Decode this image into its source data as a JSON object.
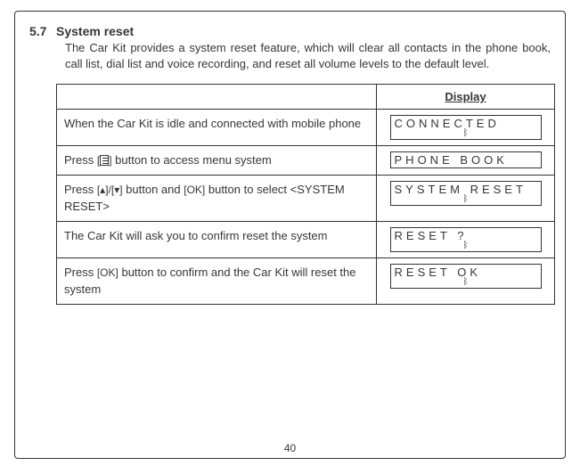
{
  "section_number": "5.7",
  "section_title": "System reset",
  "body": "The Car Kit provides a system reset feature, which will clear all contacts in the phone book, call list, dial list and voice recording, and reset all volume levels to  the default level.",
  "display_header": "Display",
  "steps": [
    {
      "text_pre": "When the Car Kit is idle and connected with mobile phone",
      "lcd": {
        "line1": "CONNECTED",
        "bt": true
      }
    },
    {
      "text_pre": "Press ",
      "key1": "[",
      "icon1": "menu",
      "key1_close": "]",
      "text_post": " button to access menu system",
      "lcd": {
        "line1": "PHONE  BOOK",
        "bt": false
      }
    },
    {
      "text_pre": "Press ",
      "key1": "[▴]/[▾]",
      "text_mid": " button and ",
      "key2": "[OK]",
      "text_post": " button to select <SYSTEM RESET>",
      "lcd": {
        "line1": "SYSTEM  RESET",
        "bt": true
      }
    },
    {
      "text_pre": "The Car Kit will ask you to confirm reset the system",
      "lcd": {
        "line1": "RESET   ?",
        "bt": true
      }
    },
    {
      "text_pre": "Press ",
      "key1": "[OK]",
      "text_post": " button to confirm and the Car Kit will reset the system",
      "lcd": {
        "line1": "RESET   OK",
        "bt": true
      }
    }
  ],
  "page_number": "40",
  "bt_glyph": "ᛒ"
}
